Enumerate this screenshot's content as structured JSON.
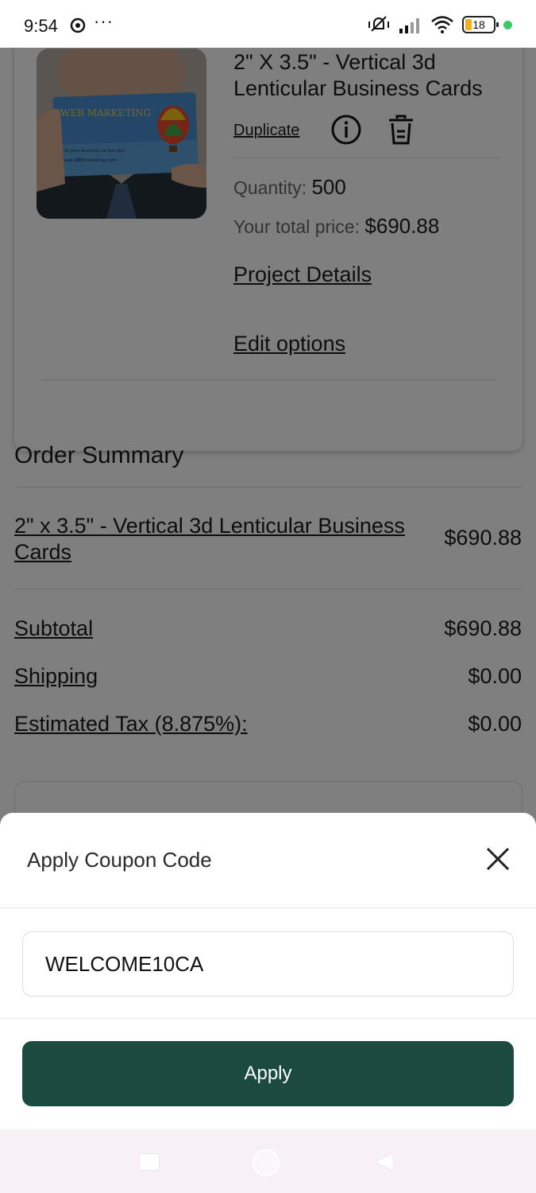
{
  "status_bar": {
    "time": "9:54",
    "dots": "···",
    "battery_level": "18",
    "icons": [
      "chrome-icon",
      "mute-vibrate-icon",
      "signal-icon",
      "wifi-icon",
      "battery-icon",
      "green-dot"
    ]
  },
  "cart_item": {
    "image_alt": "Hand holding a lenticular business card with hot air balloon",
    "image_card_brand": "WEB MARKETING",
    "image_card_tagline": "Lift your business to the sky!",
    "image_card_url": "www.WEBmarketing.com",
    "title": "2\" X 3.5\" - Vertical 3d Lenticular Business Cards",
    "duplicate_label": "Duplicate",
    "quantity_label": "Quantity:",
    "quantity_value": "500",
    "total_label": "Your total price:",
    "total_value": "$690.88",
    "project_details_label": "Project Details",
    "edit_options_label": "Edit options"
  },
  "order_summary": {
    "title": "Order Summary",
    "item_name": "2\" x 3.5\" - Vertical 3d Lenticular Business Cards",
    "item_price": "$690.88",
    "subtotal_label": "Subtotal",
    "subtotal_value": "$690.88",
    "shipping_label": "Shipping",
    "shipping_value": "$0.00",
    "tax_label": "Estimated Tax (8.875%):",
    "tax_value": "$0.00"
  },
  "coupon_sheet": {
    "title": "Apply Coupon Code",
    "input_value": "WELCOME10CA",
    "apply_label": "Apply"
  },
  "colors": {
    "apply_button": "#1a4a40",
    "overlay": "rgba(0,0,0,0.5)",
    "nav_bar": "#f7f1f6"
  }
}
